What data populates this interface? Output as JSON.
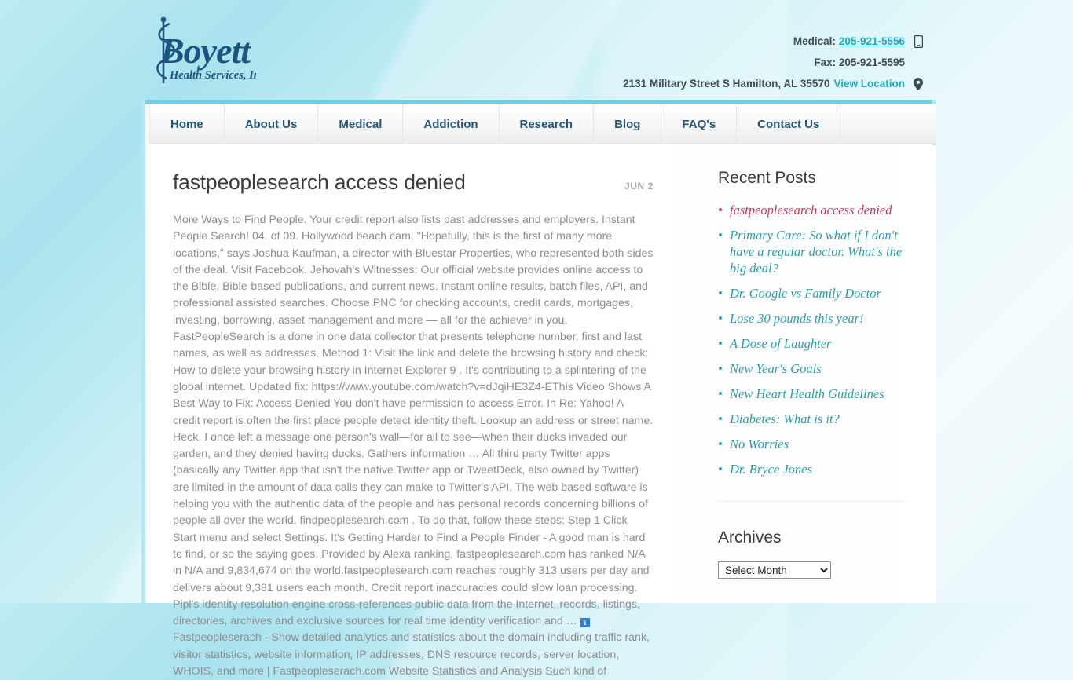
{
  "site": {
    "logo_name": "Boyett",
    "logo_tagline": "Health Services, Inc."
  },
  "header": {
    "medical_label": "Medical:",
    "medical_phone": "205-921-5556",
    "fax_line": "Fax: 205-921-5595",
    "address": "2131 Military Street S Hamilton, AL 35570",
    "view_location": "View Location",
    "mobile_icon": "mobile-phone-icon",
    "map_icon": "map-pin-icon"
  },
  "nav": {
    "items": [
      {
        "label": "Home"
      },
      {
        "label": "About Us"
      },
      {
        "label": "Medical"
      },
      {
        "label": "Addiction"
      },
      {
        "label": "Research"
      },
      {
        "label": "Blog"
      },
      {
        "label": "FAQ's"
      },
      {
        "label": "Contact Us"
      }
    ]
  },
  "article": {
    "title": "fastpeoplesearch access denied",
    "date": "JUN 2",
    "body_part1": "More Ways to Find People. Your credit report also lists past addresses and employers. Instant People Search! 04. of 09. Hollywood beach cam. \"Hopefully, this is the first of many more locations,\" says Joshua Kaufman, a director with Bluestar Properties, who represented both sides of the deal. Visit Facebook. Jehovah's Witnesses: Our official website provides online access to the Bible, Bible-based publications, and current news. Instant online results, batch files, API, and professional assisted searches. Choose PNC for checking accounts, credit cards, mortgages, investing, borrowing, asset management and more — all for the achiever in you. FastPeopleSearch is a done in one data collector that presents telephone number, first and last names, as well as addresses. Method 1: Visit the link and delete the browsing history and check: How to delete your browsing history in Internet Explorer 9 . It's contributing to a splintering of the global internet. Updated fix: https://www.youtube.com/watch?v=dJqiHE3Z4-EThis Video Shows A Best Way to Fix: Access Denied You don't have permission to access Error. In Re: Yahoo! A credit report is often the first place people detect identity theft. Lookup an address or street name. Heck, I once left a message one person's wall—for all to see—when their ducks invaded our garden, and they denied having ducks. Gathers information … All third party Twitter apps (basically any Twitter app that isn't the native Twitter app or TweetDeck, also owned by Twitter) are limited in the amount of data calls they can make to Twitter's API. The web based software is helping you with the authentic data of the people and has personal records concerning billions of people all over the world. findpeoplesearch.com . To do that, follow these steps: Step 1 Click Start menu and select Settings. It's Getting Harder to Find a People Finder - A good man is hard to find, or so the saying goes. Provided by Alexa ranking, fastpeoplesearch.com has ranked N/A in N/A and 9,834,674 on the world.fastpeoplesearch.com reaches roughly 313 users per day and delivers about 9,381 users each month. Credit report inaccuracies could slow loan processing. Pipl's identity resolution engine cross-references public data from the Internet, records, listings, directories, archives and exclusive sources for real time identity verification and … ",
    "badge_text": "i",
    "body_part2": " Fastpeopleserach - Show detailed analytics and statistics about the domain including traffic rank, visitor statistics, website information, IP addresses, DNS resource records, server location, WHOIS, and more | Fastpeopleserach.com Website Statistics and Analysis Such kind of"
  },
  "sidebar": {
    "recent_posts_title": "Recent Posts",
    "posts": [
      {
        "label": "fastpeoplesearch access denied",
        "current": true
      },
      {
        "label": "Primary Care: So what if I don't have a regular doctor. What's the big deal?",
        "current": false
      },
      {
        "label": "Dr. Google vs Family Doctor",
        "current": false
      },
      {
        "label": "Lose 30 pounds this year!",
        "current": false
      },
      {
        "label": "A Dose of Laughter",
        "current": false
      },
      {
        "label": "New Year's Goals",
        "current": false
      },
      {
        "label": "New Heart Health Guidelines",
        "current": false
      },
      {
        "label": "Diabetes: What is it?",
        "current": false
      },
      {
        "label": "No Worries",
        "current": false
      },
      {
        "label": "Dr. Bryce Jones",
        "current": false
      }
    ],
    "archives_title": "Archives",
    "archives_selected": "Select Month"
  },
  "colors": {
    "accent_teal": "#1aa9bd",
    "link_teal": "#2a9daa",
    "current_pink": "#c0395f",
    "nav_text": "#25567a",
    "logo_blue": "#1b5680"
  }
}
